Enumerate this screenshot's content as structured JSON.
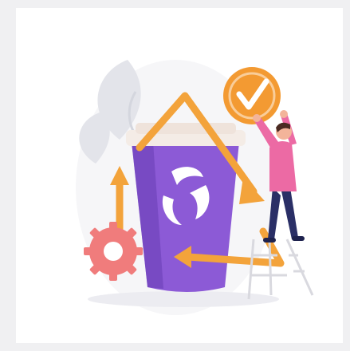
{
  "illustration": {
    "subject": "recycling-cup-with-checkmark",
    "icons": [
      "recycle-icon",
      "check-icon",
      "gear-icon",
      "ladder-icon",
      "person-icon",
      "leaf-icon"
    ],
    "colors": {
      "page_background": "#f0f0f2",
      "card_background": "#ffffff",
      "cup_purple": "#8c5ad6",
      "cup_purple_dark": "#6b3fb6",
      "cup_lid": "#f4ece6",
      "arrow_orange": "#f3a33b",
      "gear_pink": "#f07c7c",
      "badge_orange": "#f39a32",
      "leaf_gray": "#e3e4ea",
      "person_shirt": "#ec6aa4",
      "person_pants": "#2a2f66"
    }
  }
}
